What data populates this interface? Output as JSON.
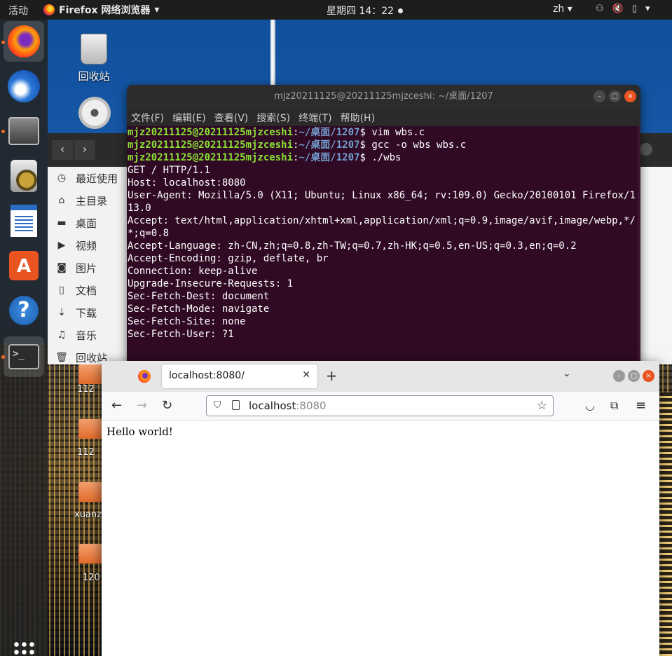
{
  "topbar": {
    "activities": "活动",
    "app_name": "Firefox 网络浏览器",
    "clock": "星期四 14：22",
    "language": "zh"
  },
  "desktop": {
    "trash_label": "回收站",
    "folder_labels": [
      "112",
      "112",
      "xuanz",
      "120"
    ]
  },
  "files": {
    "sidebar": [
      "最近使用",
      "主目录",
      "桌面",
      "视频",
      "图片",
      "文档",
      "下载",
      "音乐",
      "回收站"
    ]
  },
  "terminal": {
    "title": "mjz20211125@20211125mjzceshi: ~/桌面/1207",
    "menu": [
      "文件(F)",
      "编辑(E)",
      "查看(V)",
      "搜索(S)",
      "终端(T)",
      "帮助(H)"
    ],
    "prompt_user": "mjz20211125@20211125mjzceshi",
    "prompt_path": "~/桌面/1207",
    "commands": [
      "vim wbs.c",
      "gcc -o wbs wbs.c",
      "./wbs"
    ],
    "output": [
      "GET / HTTP/1.1",
      "Host: localhost:8080",
      "User-Agent: Mozilla/5.0 (X11; Ubuntu; Linux x86_64; rv:109.0) Gecko/20100101 Firefox/113.0",
      "Accept: text/html,application/xhtml+xml,application/xml;q=0.9,image/avif,image/webp,*/*;q=0.8",
      "Accept-Language: zh-CN,zh;q=0.8,zh-TW;q=0.7,zh-HK;q=0.5,en-US;q=0.3,en;q=0.2",
      "Accept-Encoding: gzip, deflate, br",
      "Connection: keep-alive",
      "Upgrade-Insecure-Requests: 1",
      "Sec-Fetch-Dest: document",
      "Sec-Fetch-Mode: navigate",
      "Sec-Fetch-Site: none",
      "Sec-Fetch-User: ?1"
    ]
  },
  "browser": {
    "tab_title": "localhost:8080/",
    "url_host": "localhost",
    "url_port": ":8080",
    "page_text": "Hello world!"
  }
}
